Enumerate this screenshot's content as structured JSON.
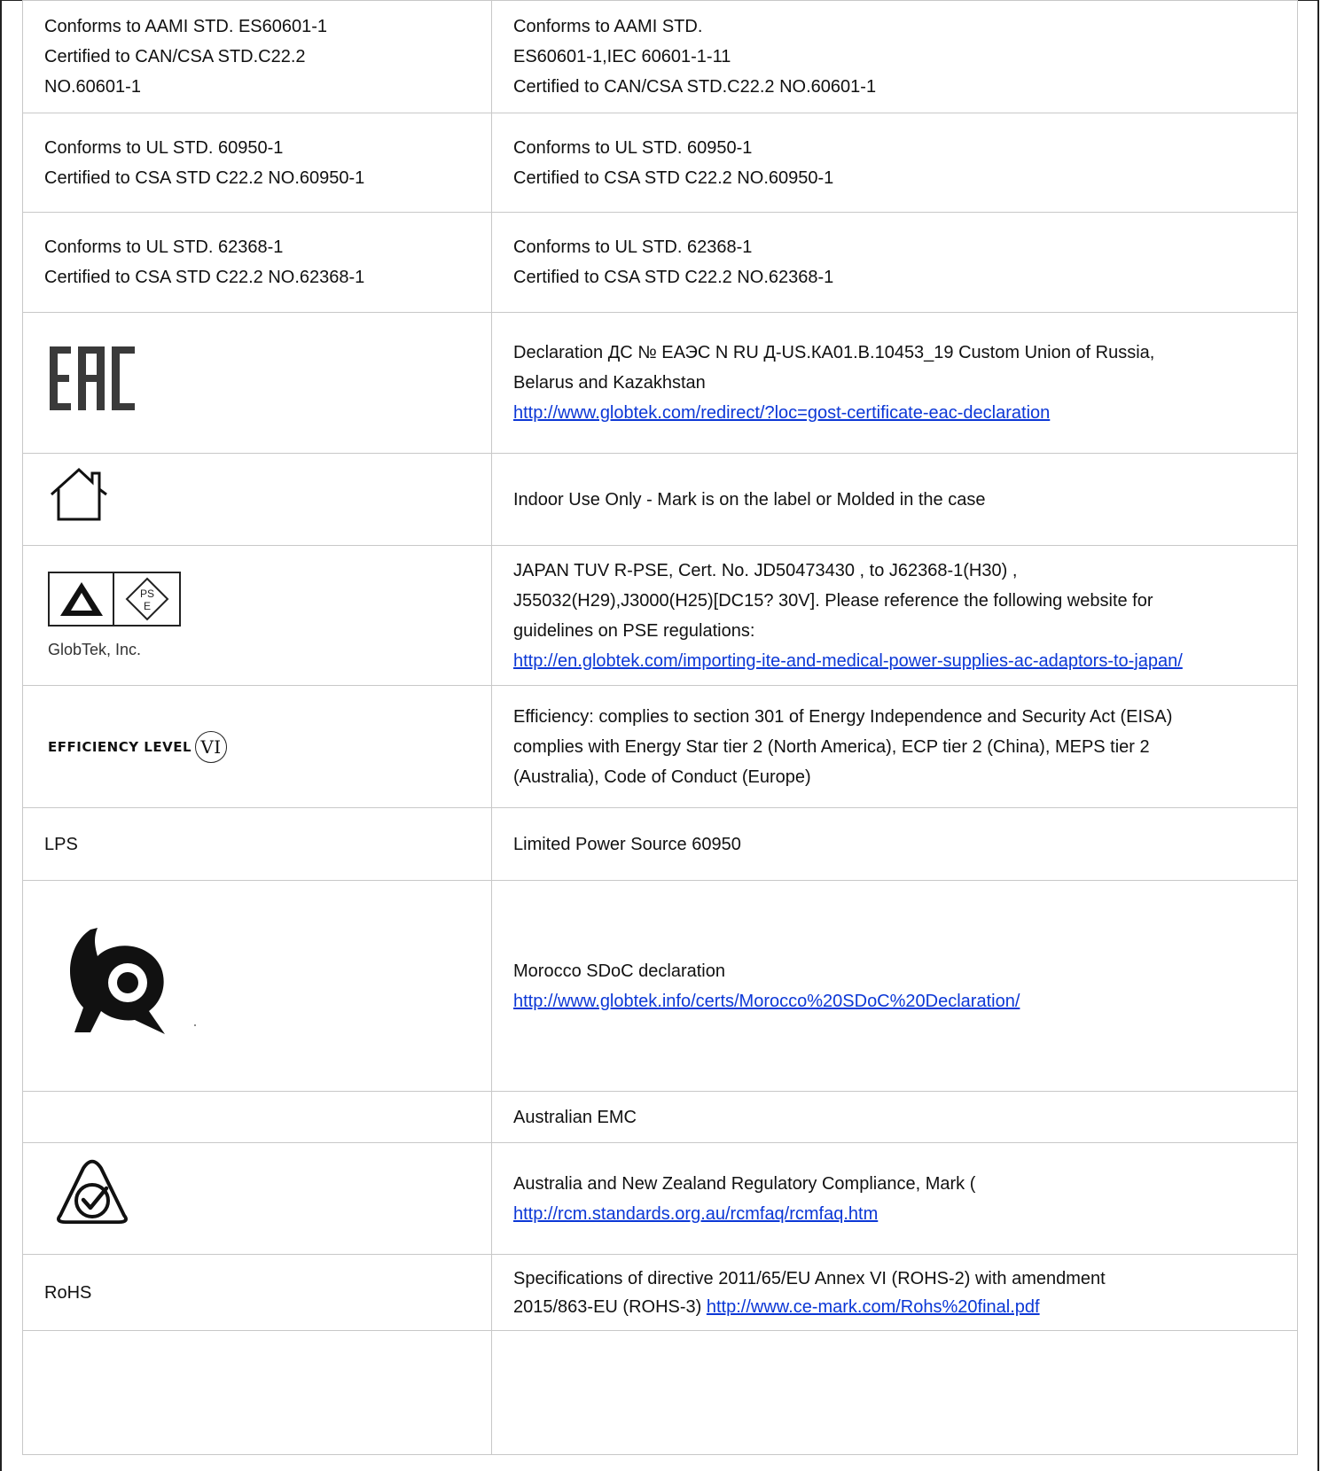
{
  "rows": [
    {
      "left": [
        "Conforms to AAMI STD. ES60601-1",
        "Certified to CAN/CSA STD.C22.2",
        "NO.60601-1"
      ],
      "right": [
        "Conforms to AAMI STD.",
        "ES60601-1,IEC 60601-1-11",
        "Certified to CAN/CSA STD.C22.2 NO.60601-1"
      ]
    },
    {
      "left": [
        "Conforms to UL STD. 60950-1",
        "Certified to CSA STD C22.2 NO.60950-1"
      ],
      "right": [
        "Conforms to UL STD. 60950-1",
        "Certified to CSA STD C22.2 NO.60950-1"
      ]
    },
    {
      "left": [
        "Conforms to UL STD. 62368-1",
        "Certified to CSA STD C22.2 NO.62368-1"
      ],
      "right": [
        "Conforms to UL STD. 62368-1",
        "Certified to CSA STD C22.2 NO.62368-1"
      ]
    },
    {
      "logo": "eac-mark",
      "logo_text": "EAC",
      "right": [
        "Declaration ДС № ЕАЭС N RU Д-US.КА01.В.10453_19 Custom Union of Russia,",
        "Belarus and Kazakhstan"
      ],
      "link": "http://www.globtek.com/redirect/?loc=gost-certificate-eac-declaration"
    },
    {
      "logo": "house-icon",
      "right": [
        "Indoor Use Only - Mark is on the label or Molded in the case"
      ]
    },
    {
      "logo": "pse-mark",
      "logo_caption": "GlobTek, Inc.",
      "pse_text": "PS E",
      "right": [
        "JAPAN TUV R-PSE, Cert. No. JD50473430 , to J62368-1(H30) ,",
        "J55032(H29),J3000(H25)[DC15? 30V]. Please reference the following website for",
        "guidelines on PSE regulations:"
      ],
      "link": "http://en.globtek.com/importing-ite-and-medical-power-supplies-ac-adaptors-to-japan/"
    },
    {
      "logo": "efficiency-level-mark",
      "logo_text": "EFFICIENCY LEVEL",
      "logo_numeral": "VI",
      "right": [
        "Efficiency: complies to section 301 of Energy Independence and Security Act (EISA)",
        "complies with Energy Star tier 2 (North America), ECP tier 2 (China), MEPS tier 2",
        "(Australia), Code of Conduct (Europe)"
      ]
    },
    {
      "left": [
        "LPS"
      ],
      "right": [
        "Limited Power Source 60950"
      ]
    },
    {
      "logo": "morocco-cmim-mark",
      "right": [
        "Morocco SDoC declaration"
      ],
      "link": "http://www.globtek.info/certs/Morocco%20SDoC%20Declaration/"
    },
    {
      "left": [],
      "right": [
        "Australian EMC"
      ]
    },
    {
      "logo": "rcm-mark",
      "right": [
        "Australia and New Zealand Regulatory Compliance, Mark ("
      ],
      "link": "http://rcm.standards.org.au/rcmfaq/rcmfaq.htm"
    },
    {
      "left": [
        "RoHS"
      ],
      "right": [
        "Specifications of directive 2011/65/EU Annex VI (ROHS-2) with amendment",
        "2015/863-EU (ROHS-3)"
      ],
      "inline_link": "http://www.ce-mark.com/Rohs%20final.pdf"
    }
  ],
  "colors": {
    "link": "#0b37d6",
    "grid": "#c8c8c8",
    "frame": "#222222"
  }
}
